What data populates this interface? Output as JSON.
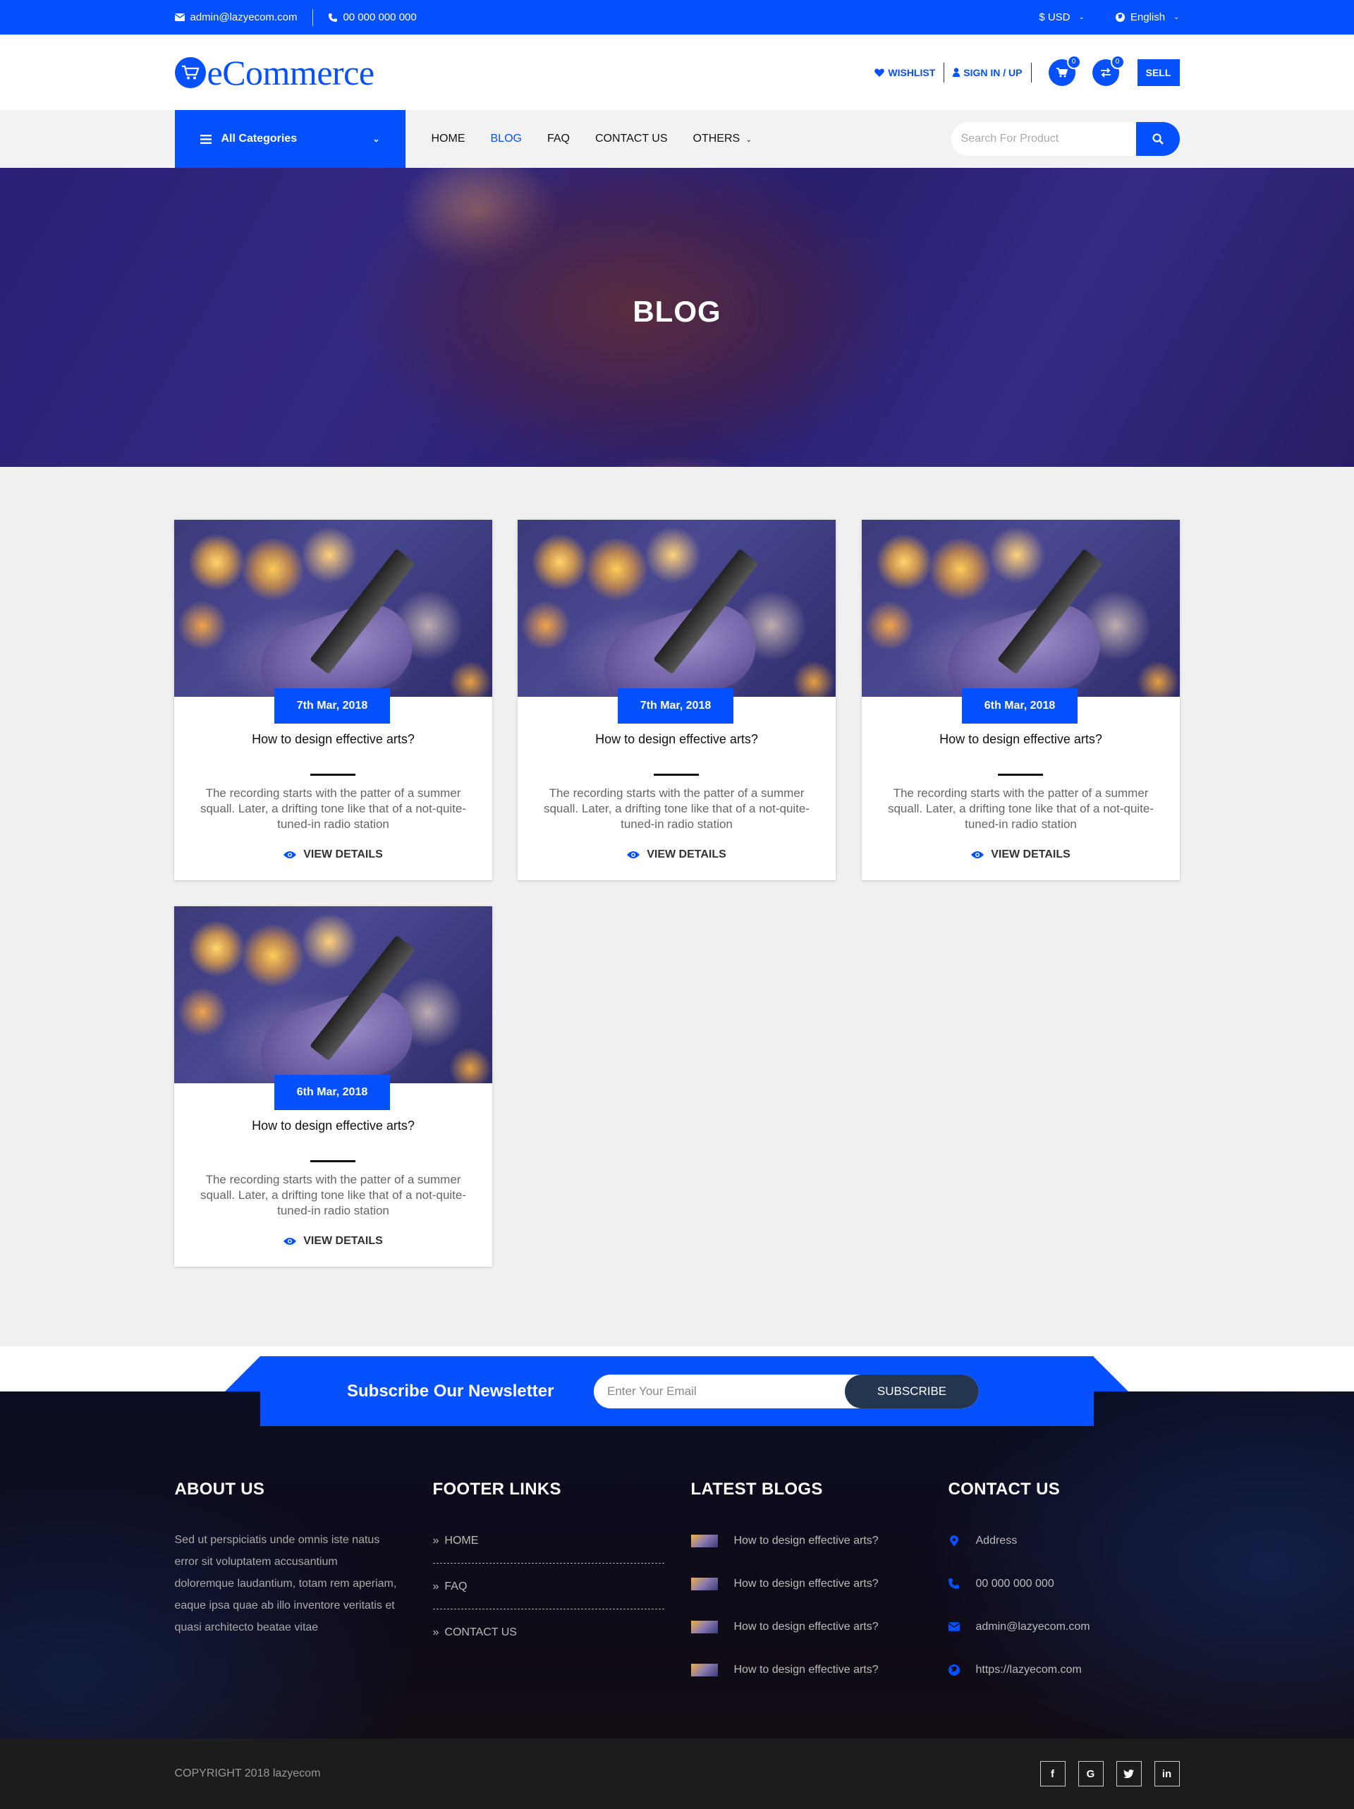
{
  "topbar": {
    "email": "admin@lazyecom.com",
    "phone": "00 000 000 000",
    "currency": "$ USD",
    "language": "English"
  },
  "header": {
    "logo_text": "eCommerce",
    "wishlist": "WISHLIST",
    "signin": "SIGN IN / UP",
    "cart_count": "0",
    "compare_count": "0",
    "sell": "SELL"
  },
  "nav": {
    "categories": "All Categories",
    "items": [
      "HOME",
      "BLOG",
      "FAQ",
      "CONTACT US",
      "OTHERS"
    ],
    "active": "BLOG",
    "search_placeholder": "Search For Product"
  },
  "hero": {
    "title": "BLOG"
  },
  "posts": [
    {
      "date": "7th Mar, 2018",
      "title": "How to design effective arts?",
      "excerpt": "The recording starts with the patter of a summer squall. Later, a drifting tone like that of a not-quite-tuned-in radio station",
      "link": "VIEW DETAILS"
    },
    {
      "date": "7th Mar, 2018",
      "title": "How to design effective arts?",
      "excerpt": "The recording starts with the patter of a summer squall. Later, a drifting tone like that of a not-quite-tuned-in radio station",
      "link": "VIEW DETAILS"
    },
    {
      "date": "6th Mar, 2018",
      "title": "How to design effective arts?",
      "excerpt": "The recording starts with the patter of a summer squall. Later, a drifting tone like that of a not-quite-tuned-in radio station",
      "link": "VIEW DETAILS"
    },
    {
      "date": "6th Mar, 2018",
      "title": "How to design effective arts?",
      "excerpt": "The recording starts with the patter of a summer squall. Later, a drifting tone like that of a not-quite-tuned-in radio station",
      "link": "VIEW DETAILS"
    }
  ],
  "newsletter": {
    "title": "Subscribe Our Newsletter",
    "placeholder": "Enter Your Email",
    "button": "SUBSCRIBE"
  },
  "footer": {
    "about_title": "ABOUT US",
    "about_text": "Sed ut perspiciatis unde omnis iste natus error sit voluptatem accusantium doloremque laudantium, totam rem aperiam, eaque ipsa quae ab illo inventore veritatis et quasi architecto beatae vitae",
    "links_title": "FOOTER LINKS",
    "links": [
      "HOME",
      "FAQ",
      "CONTACT US"
    ],
    "blogs_title": "LATEST BLOGS",
    "blogs": [
      "How to design effective arts?",
      "How to design effective arts?",
      "How to design effective arts?",
      "How to design effective arts?"
    ],
    "contact_title": "CONTACT US",
    "contact": {
      "address": "Address",
      "phone": "00 000 000 000",
      "email": "admin@lazyecom.com",
      "website": "https://lazyecom.com"
    },
    "copyright": "COPYRIGHT 2018 lazyecom",
    "socials": [
      "facebook-icon",
      "google-icon",
      "twitter-icon",
      "linkedin-icon"
    ]
  },
  "colors": {
    "primary": "#0550ff",
    "dark": "#1c1c1c",
    "subscribe_btn": "#243550"
  }
}
